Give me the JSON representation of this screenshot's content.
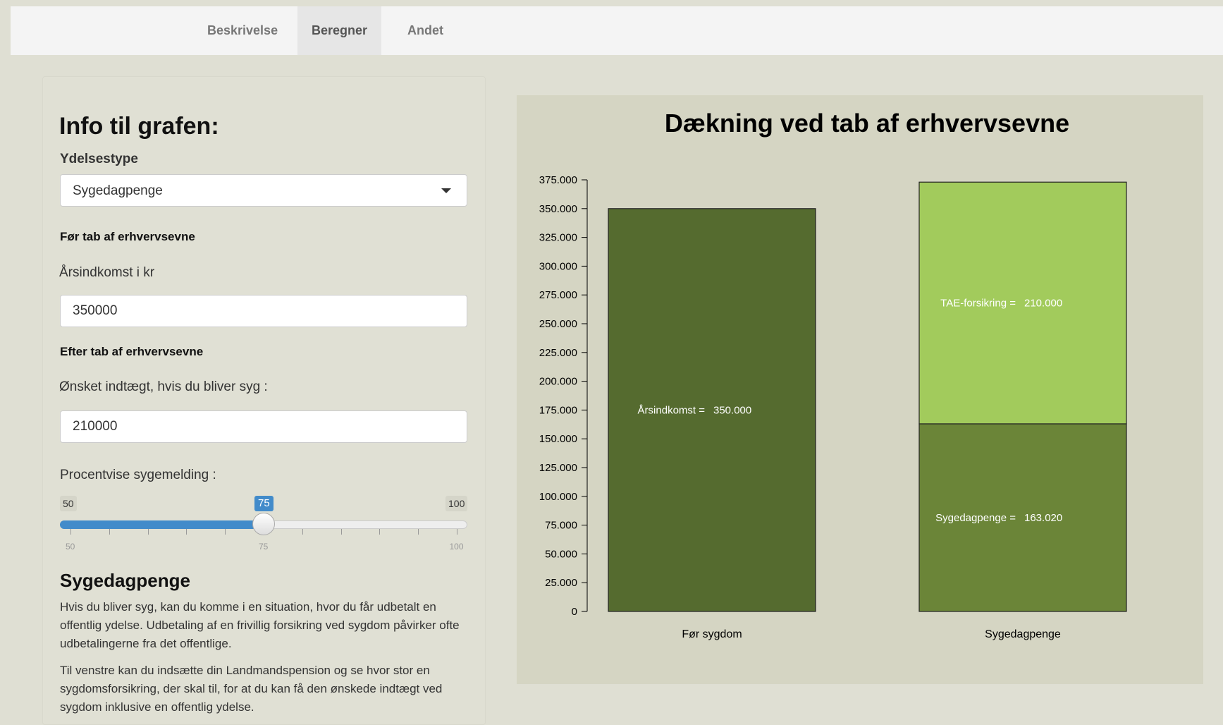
{
  "nav": {
    "tabs": [
      {
        "label": "Beskrivelse",
        "active": false
      },
      {
        "label": "Beregner",
        "active": true
      },
      {
        "label": "Andet",
        "active": false
      }
    ]
  },
  "sidebar": {
    "title": "Info til grafen:",
    "benefit_type": {
      "label": "Ydelsestype",
      "selected": "Sygedagpenge"
    },
    "before_heading": "Før tab af erhvervsevne",
    "income": {
      "label": "Årsindkomst i kr",
      "value": "350000"
    },
    "after_heading": "Efter tab af erhvervsevne",
    "desired": {
      "label": "Ønsket indtægt, hvis du bliver syg :",
      "value": "210000"
    },
    "slider": {
      "label": "Procentvise sygemelding :",
      "min": 50,
      "max": 100,
      "value": 75,
      "min_label": "50",
      "max_label": "100",
      "value_label": "75",
      "tick_labels": [
        "50",
        "75",
        "100"
      ]
    },
    "section_title": "Sygedagpenge",
    "paragraphs": [
      "Hvis du bliver syg, kan du komme i en situation, hvor du får udbetalt en offentlig ydelse. Udbetaling af en frivillig forsikring ved sygdom påvirker ofte udbetalingerne fra det offentlige.",
      "Til venstre kan du indsætte din Landmandspension og se hvor stor en sygdomsforsikring, der skal til, for at du kan få den ønskede indtægt ved sygdom inklusive en offentlig ydelse."
    ]
  },
  "colors": {
    "bar_before": "#556b2f",
    "bar_benefit": "#6b8538",
    "bar_insurance": "#a2cb5c",
    "panel_bg": "#d5d5c3",
    "slider_accent": "#428bca"
  },
  "chart_data": {
    "type": "bar",
    "stacked": true,
    "title": "Dækning ved tab af erhvervsevne",
    "categories": [
      "Før sygdom",
      "Sygedagpenge"
    ],
    "ylim": [
      0,
      375000
    ],
    "yticks": [
      0,
      25000,
      50000,
      75000,
      100000,
      125000,
      150000,
      175000,
      200000,
      225000,
      250000,
      275000,
      300000,
      325000,
      350000,
      375000
    ],
    "ytick_labels": [
      "0",
      "25.000",
      "50.000",
      "75.000",
      "100.000",
      "125.000",
      "150.000",
      "175.000",
      "200.000",
      "225.000",
      "250.000",
      "275.000",
      "300.000",
      "325.000",
      "350.000",
      "375.000"
    ],
    "segments": [
      {
        "category": "Før sygdom",
        "label": "Årsindkomst =",
        "value_label": "350.000",
        "value": 350000,
        "base": 0,
        "color": "#556b2f"
      },
      {
        "category": "Sygedagpenge",
        "label": "Sygedagpenge =",
        "value_label": "163.020",
        "value": 163020,
        "base": 0,
        "color": "#6b8538"
      },
      {
        "category": "Sygedagpenge",
        "label": "TAE-forsikring =",
        "value_label": "210.000",
        "value": 210000,
        "base": 163020,
        "color": "#a2cb5c"
      }
    ],
    "grid": false
  }
}
